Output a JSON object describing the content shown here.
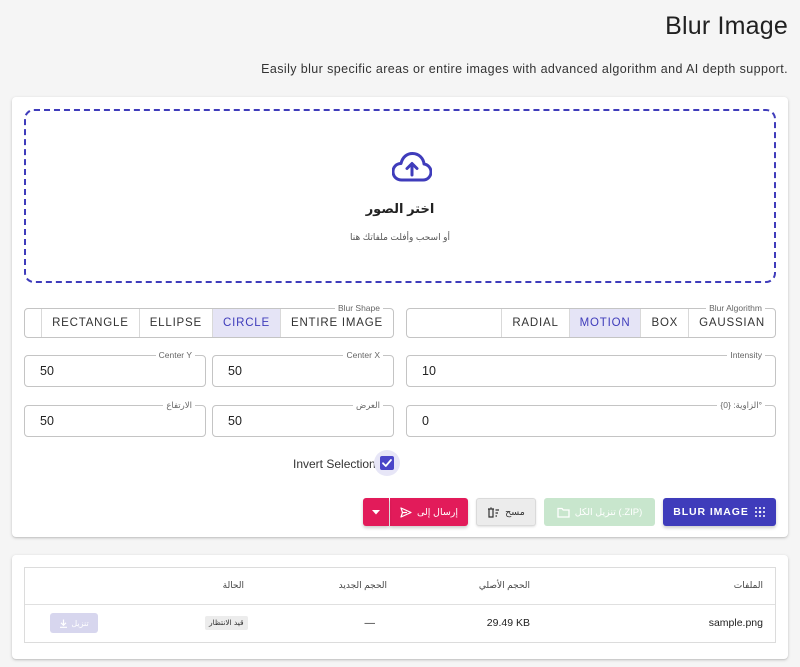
{
  "header": {
    "title": "Blur Image",
    "subtitle": "Easily blur specific areas or entire images with advanced algorithm and AI depth support."
  },
  "upload": {
    "title": "اختر الصور",
    "subtitle": "أو اسحب وأفلت ملفاتك هنا"
  },
  "blur_algorithm": {
    "legend": "Blur Algorithm",
    "options": [
      "GAUSSIAN",
      "BOX",
      "MOTION",
      "RADIAL"
    ],
    "selected": "MOTION"
  },
  "blur_shape": {
    "legend": "Blur Shape",
    "options": [
      "ENTIRE IMAGE",
      "CIRCLE",
      "ELLIPSE",
      "RECTANGLE"
    ],
    "selected": "CIRCLE"
  },
  "fields": {
    "intensity": {
      "label": "Intensity",
      "value": "10"
    },
    "center_x": {
      "label": "Center X",
      "value": "50"
    },
    "center_y": {
      "label": "Center Y",
      "value": "50"
    },
    "angle": {
      "label": "الزاوية: {0}°",
      "value": "0"
    },
    "width": {
      "label": "العرض",
      "value": "50"
    },
    "height": {
      "label": "الارتفاع",
      "value": "50"
    }
  },
  "invert": {
    "label": "Invert Selection",
    "checked": true
  },
  "actions": {
    "blur": "BLUR IMAGE",
    "download_zip": "تنزيل الكل (.ZIP)",
    "clear": "مسح",
    "send_to": "إرسال إلى"
  },
  "table": {
    "headers": {
      "files": "الملفات",
      "original_size": "الحجم الأصلي",
      "new_size": "الحجم الجديد",
      "status": "الحالة"
    },
    "rows": [
      {
        "file": "sample.png",
        "original_size": "29.49 KB",
        "new_size": "—",
        "status": "قيد الانتظار",
        "download": "تنزيل"
      }
    ]
  },
  "colors": {
    "primary": "#3f3cbb",
    "accent": "#e21b5a",
    "success_disabled": "#c8e6cd",
    "selected_bg": "#e5e4f6"
  }
}
